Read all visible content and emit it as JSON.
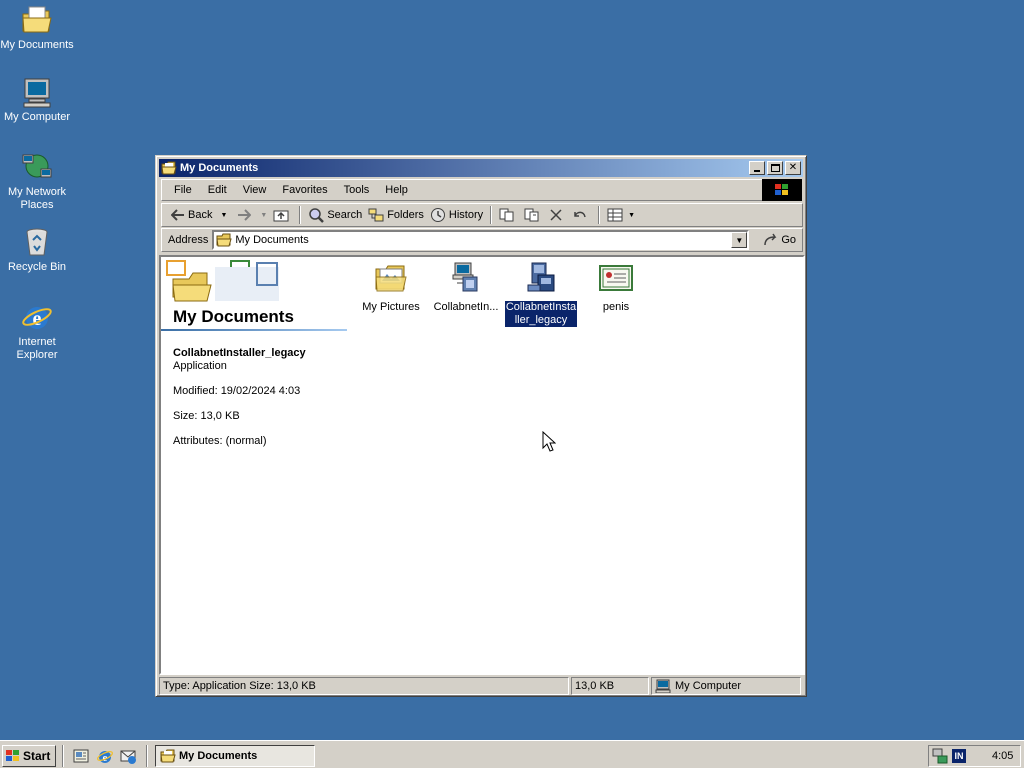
{
  "desktop": {
    "icons": [
      {
        "label": "My Documents",
        "icon": "folder-documents-icon"
      },
      {
        "label": "My Computer",
        "icon": "computer-icon"
      },
      {
        "label": "My Network Places",
        "icon": "network-icon"
      },
      {
        "label": "Recycle Bin",
        "icon": "recycle-bin-icon"
      },
      {
        "label": "Internet Explorer",
        "icon": "internet-explorer-icon"
      }
    ]
  },
  "window": {
    "title": "My Documents",
    "menu": [
      "File",
      "Edit",
      "View",
      "Favorites",
      "Tools",
      "Help"
    ],
    "toolbar": {
      "back": "Back",
      "search": "Search",
      "folders": "Folders",
      "history": "History"
    },
    "address": {
      "label": "Address",
      "value": "My Documents",
      "go": "Go"
    },
    "sidebar": {
      "title": "My Documents",
      "selected_name": "CollabnetInstaller_legacy",
      "selected_type": "Application",
      "modified": "Modified: 19/02/2024 4:03",
      "size": "Size: 13,0 KB",
      "attributes": "Attributes: (normal)"
    },
    "files": [
      {
        "label": "My Pictures",
        "icon": "pictures-folder-icon",
        "selected": false
      },
      {
        "label": "CollabnetIn...",
        "icon": "installer-app-icon",
        "selected": false
      },
      {
        "label": "CollabnetInstaller_legacy",
        "label_line1": "CollabnetInsta",
        "label_line2": "ller_legacy",
        "icon": "installer-app-icon",
        "selected": true
      },
      {
        "label": "penis",
        "icon": "certificate-icon",
        "selected": false
      }
    ],
    "status": {
      "info": "Type: Application Size: 13,0 KB",
      "size": "13,0 KB",
      "zone": "My Computer"
    }
  },
  "taskbar": {
    "start": "Start",
    "task": "My Documents",
    "tray_lang": "IN",
    "clock": "4:05"
  },
  "colors": {
    "desktop": "#3a6ea5",
    "title_active": "#0a246a",
    "face": "#d4d0c8",
    "selection": "#0a246a"
  }
}
